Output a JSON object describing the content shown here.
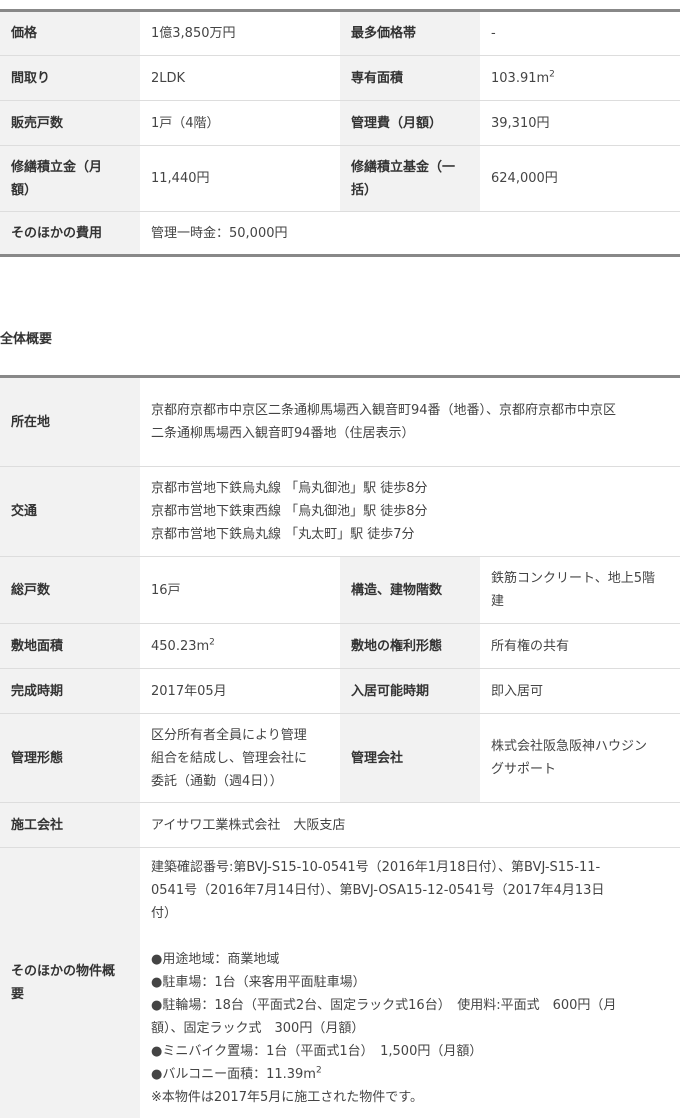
{
  "price_table": {
    "price_label": "価格",
    "price_value": "1億3,850万円",
    "max_price_band_label": "最多価格帯",
    "max_price_band_value": "-",
    "layout_label": "間取り",
    "layout_value": "2LDK",
    "area_label": "専有面積",
    "area_value": "103.91m",
    "area_sup": "2",
    "units_label": "販売戸数",
    "units_value": "1戸（4階）",
    "mgmt_fee_label": "管理費（月額）",
    "mgmt_fee_value": "39,310円",
    "repair_reserve_label_1": "修繕積立金（月",
    "repair_reserve_label_2": "額）",
    "repair_reserve_value": "11,440円",
    "repair_fund_label_1": "修繕積立基金（一",
    "repair_fund_label_2": "括）",
    "repair_fund_value": "624,000円",
    "other_costs_label": "そのほかの費用",
    "other_costs_value": "管理一時金：50,000円"
  },
  "overview": {
    "title": "全体概要",
    "address_label": "所在地",
    "address_line1": "京都府京都市中京区二条通柳馬場西入観音町94番（地番）、京都府京都市中京区",
    "address_line2": "二条通柳馬場西入観音町94番地（住居表示）",
    "transport_label": "交通",
    "transport_lines": [
      "京都市営地下鉄烏丸線 「烏丸御池」駅 徒歩8分",
      "京都市営地下鉄東西線 「烏丸御池」駅 徒歩8分",
      "京都市営地下鉄烏丸線 「丸太町」駅 徒歩7分"
    ],
    "total_units_label": "総戸数",
    "total_units_value": "16戸",
    "structure_label": "構造、建物階数",
    "structure_line1": "鉄筋コンクリート、地上5階",
    "structure_line2": "建",
    "site_area_label": "敷地面積",
    "site_area_value": "450.23m",
    "site_area_sup": "2",
    "land_rights_label": "敷地の権利形態",
    "land_rights_value": "所有権の共有",
    "completion_label": "完成時期",
    "completion_value": "2017年05月",
    "move_in_label": "入居可能時期",
    "move_in_value": "即入居可",
    "mgmt_form_label": "管理形態",
    "mgmt_form_lines": [
      "区分所有者全員により管理",
      "組合を結成し、管理会社に",
      "委託（通勤（週4日））"
    ],
    "mgmt_company_label": "管理会社",
    "mgmt_company_line1": "株式会社阪急阪神ハウジン",
    "mgmt_company_line2": "グサポート",
    "builder_label": "施工会社",
    "builder_value": "アイサワ工業株式会社　大阪支店",
    "other_label_1": "そのほかの物件概",
    "other_label_2": "要",
    "other_lines": [
      "建築確認番号:第BVJ-S15-10-0541号（2016年1月18日付）、第BVJ-S15-11-",
      "0541号（2016年7月14日付）、第BVJ-OSA15-12-0541号（2017年4月13日",
      "付）"
    ],
    "other_bullets": [
      "●用途地域：商業地域",
      "●駐車場：1台（来客用平面駐車場）",
      "●駐輪場：18台（平面式2台、固定ラック式16台）　使用料:平面式　600円（月",
      "額）、固定ラック式　300円（月額）",
      "●ミニバイク置場：1台（平面式1台）　1,500円（月額）"
    ],
    "balcony_text": "●バルコニー面積：11.39m",
    "balcony_sup": "2",
    "note": "※本物件は2017年5月に施工された物件です。"
  }
}
